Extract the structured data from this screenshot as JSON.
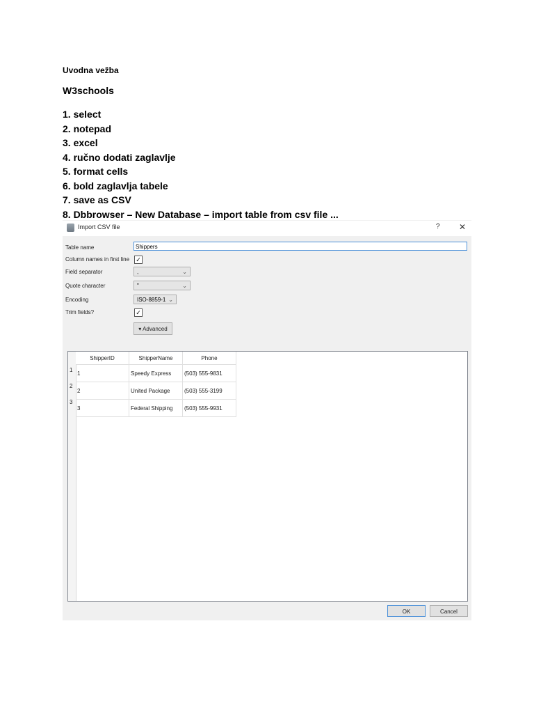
{
  "document": {
    "heading_small": "Uvodna vežba",
    "heading_w3": "W3schools",
    "steps": [
      "1. select",
      "2. notepad",
      "3. excel",
      "4. ručno dodati zaglavlje",
      "5. format cells",
      "6. bold zaglavlja tabele",
      "7. save as CSV",
      "8. Dbbrowser – New Database – import table from csv file ..."
    ]
  },
  "dialog": {
    "title": "Import CSV file",
    "help": "?",
    "close": "✕",
    "labels": {
      "table_name": "Table name",
      "column_names": "Column names in first line",
      "field_separator": "Field separator",
      "quote_character": "Quote character",
      "encoding": "Encoding",
      "trim_fields": "Trim fields?"
    },
    "table_name_value": "Shippers",
    "column_names_checked": "✓",
    "trim_fields_checked": "✓",
    "field_separator_value": ",",
    "quote_character_value": "\"",
    "encoding_value": "ISO-8859-1",
    "caret": "⌄",
    "advanced_label": "▾  Advanced",
    "preview": {
      "headers": [
        "ShipperID",
        "ShipperName",
        "Phone"
      ],
      "rows": [
        {
          "num": "1",
          "cells": [
            "1",
            "Speedy Express",
            "(503) 555-9831"
          ]
        },
        {
          "num": "2",
          "cells": [
            "2",
            "United Package",
            "(503) 555-3199"
          ]
        },
        {
          "num": "3",
          "cells": [
            "3",
            "Federal Shipping",
            "(503) 555-9931"
          ]
        }
      ]
    },
    "ok_label": "OK",
    "cancel_label": "Cancel"
  }
}
